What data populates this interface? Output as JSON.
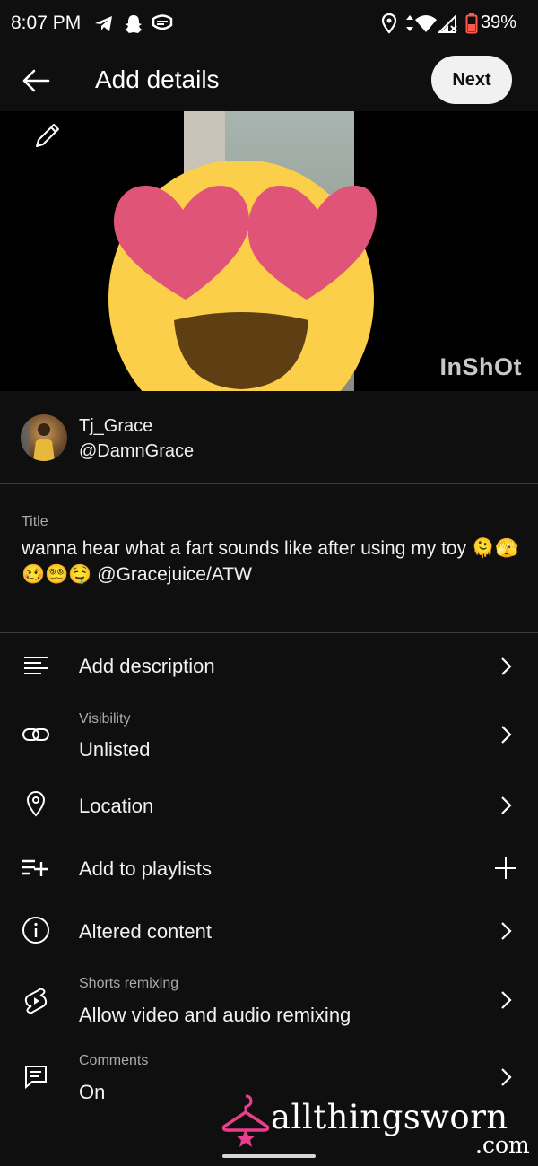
{
  "status_bar": {
    "time": "8:07 PM",
    "left_icons": [
      "telegram-icon",
      "snapchat-icon",
      "messaging-icon"
    ],
    "right_icons": [
      "location-icon",
      "data-arrows-icon",
      "wifi-icon",
      "signal-icon",
      "battery-icon"
    ],
    "battery": "39%",
    "battery_color": "#ff5a4d"
  },
  "app_bar": {
    "title": "Add details",
    "next_label": "Next"
  },
  "preview": {
    "watermark": "InShOt"
  },
  "channel": {
    "name": "Tj_Grace",
    "handle": "@DamnGrace"
  },
  "title_field": {
    "label": "Title",
    "value": "wanna hear what a fart sounds like after using my toy 🫠🫣🥴😵‍💫🤤 @Gracejuice/ATW"
  },
  "rows": {
    "description": {
      "label": "Add description",
      "icon": "description-lines-icon"
    },
    "visibility": {
      "sublabel": "Visibility",
      "label": "Unlisted",
      "icon": "link-icon"
    },
    "location": {
      "label": "Location",
      "icon": "location-pin-icon"
    },
    "playlists": {
      "label": "Add to playlists",
      "icon": "playlist-add-icon"
    },
    "altered": {
      "label": "Altered content",
      "icon": "info-icon"
    },
    "remixing": {
      "sublabel": "Shorts remixing",
      "label": "Allow video and audio remixing",
      "icon": "shorts-icon"
    },
    "comments": {
      "sublabel": "Comments",
      "label": "On",
      "icon": "comment-icon"
    }
  },
  "brand_overlay": {
    "text": "allthingsworn",
    "domain": ".com",
    "accent": "#e83e8c"
  },
  "colors": {
    "background": "#0f0f0f",
    "divider": "#3d3d3d",
    "secondary_text": "#aaaaaa"
  }
}
